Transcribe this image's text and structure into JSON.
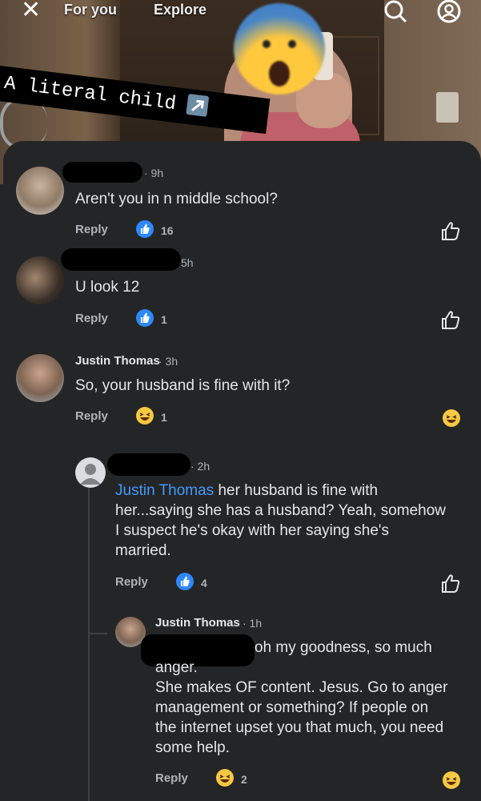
{
  "nav": {
    "close_glyph": "✕",
    "tabs": [
      "For you",
      "Explore"
    ],
    "search_icon": "search-icon",
    "profile_icon": "profile-icon"
  },
  "caption": {
    "text": "A literal child",
    "icon": "arrow-up-right-icon"
  },
  "reaction_icons": {
    "like": "like-icon",
    "haha": "haha-icon",
    "like_outline": "like-outline-icon"
  },
  "colors": {
    "background": "#242526",
    "mention": "#4599ff",
    "like_blue": "#2d88ff",
    "text": "#e4e6eb",
    "muted": "#b0b3b8"
  },
  "comments": [
    {
      "author": "",
      "time": "· 9h",
      "text": "Aren't you in n middle school?",
      "reply": "Reply",
      "reaction": "like",
      "count": "16"
    },
    {
      "author": "",
      "time": "5h",
      "text": "U look 12",
      "reply": "Reply",
      "reaction": "like",
      "count": "1"
    },
    {
      "author": "Justin Thomas",
      "time": "· 3h",
      "text": "So, your husband is fine with it?",
      "reply": "Reply",
      "reaction": "haha",
      "count": "1"
    },
    {
      "author": "",
      "time": "· 2h",
      "mention": "Justin Thomas",
      "text_line1": " her husband is fine with",
      "text_line2": "her...saying she has a husband? Yeah, somehow",
      "text_line3": "I suspect he's okay with her saying she's",
      "text_line4": "married.",
      "reply": "Reply",
      "reaction": "like",
      "count": "4"
    },
    {
      "author": "Justin Thomas",
      "time": "· 1h",
      "text_line1": "oh my goodness, so much",
      "text_line2": "anger.",
      "text_line3": "She makes OF content. Jesus. Go to anger",
      "text_line4": "management or something? If people on",
      "text_line5": "the internet upset you that much, you need",
      "text_line6": "some help.",
      "reply": "Reply",
      "reaction": "haha",
      "count": "2"
    }
  ]
}
